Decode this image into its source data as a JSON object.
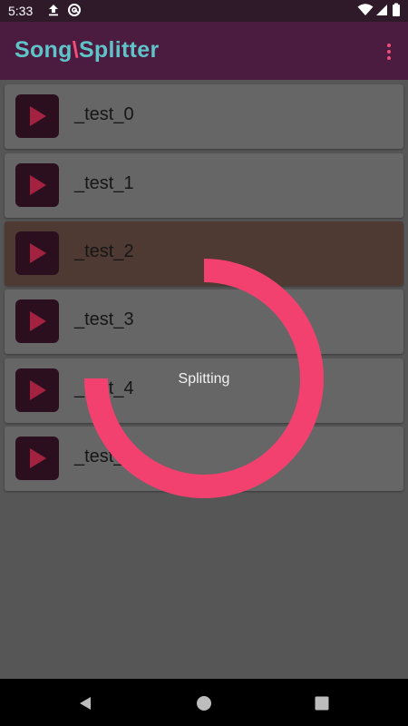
{
  "status_bar": {
    "time": "5:33",
    "icons": [
      "upload-icon",
      "at-sign-icon",
      "wifi-icon",
      "signal-icon",
      "battery-icon"
    ]
  },
  "app_bar": {
    "brand_part1": "Song",
    "brand_sep": "\\",
    "brand_part2": "Splitter",
    "menu_icon": "more-vert-icon"
  },
  "songs": [
    {
      "title": "_test_0",
      "selected": false
    },
    {
      "title": "_test_1",
      "selected": false
    },
    {
      "title": "_test_2",
      "selected": true
    },
    {
      "title": "_test_3",
      "selected": false
    },
    {
      "title": "_test_4",
      "selected": false
    },
    {
      "title": "_test_",
      "selected": false
    }
  ],
  "progress": {
    "label": "Splitting",
    "fraction": 0.75,
    "color": "#f2416f"
  },
  "colors": {
    "app_bar": "#4b1b40",
    "accent": "#f04e78",
    "brand": "#5fc3c8"
  },
  "nav_bar": {
    "icons": [
      "back-icon",
      "home-icon",
      "recents-icon"
    ]
  }
}
